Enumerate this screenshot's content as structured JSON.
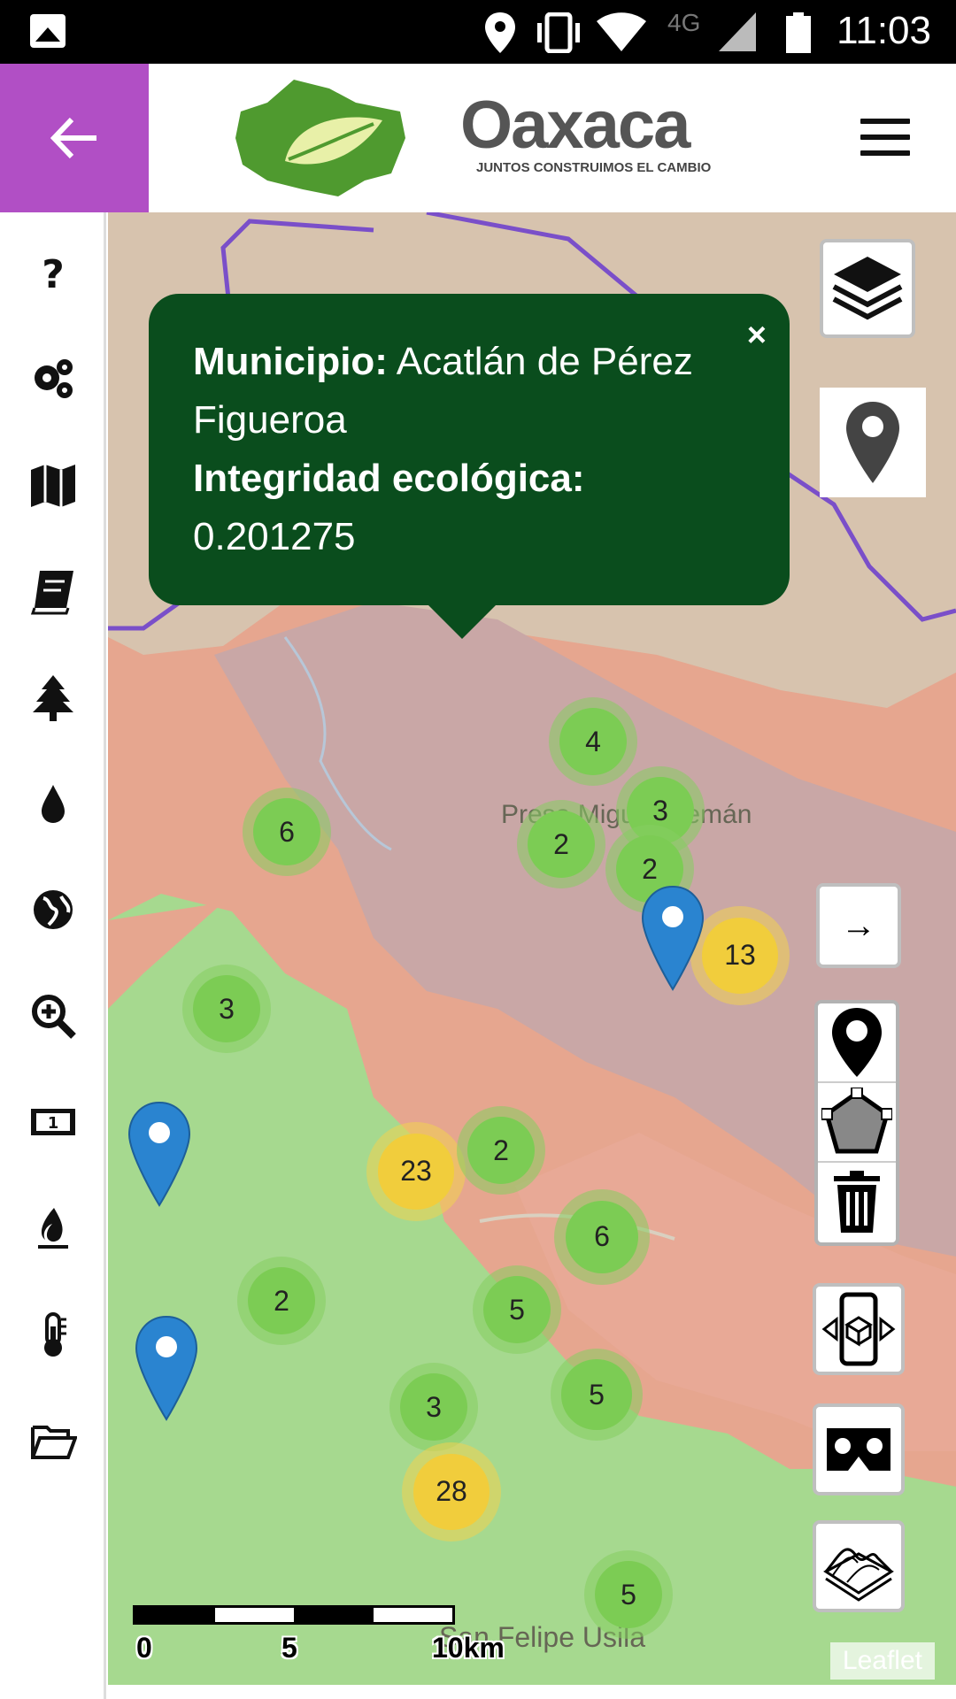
{
  "status_bar": {
    "network": "4G",
    "time": "11:03"
  },
  "header": {
    "brand_name": "Oaxaca",
    "brand_tagline": "JUNTOS CONSTRUIMOS EL CAMBIO"
  },
  "sidebar": {
    "items": [
      {
        "icon": "help-icon",
        "label": "?"
      },
      {
        "icon": "settings-icon"
      },
      {
        "icon": "map-icon"
      },
      {
        "icon": "book-icon"
      },
      {
        "icon": "tree-icon"
      },
      {
        "icon": "water-drop-icon"
      },
      {
        "icon": "globe-icon"
      },
      {
        "icon": "zoom-in-icon"
      },
      {
        "icon": "money-icon"
      },
      {
        "icon": "fire-icon"
      },
      {
        "icon": "thermometer-icon"
      },
      {
        "icon": "folder-open-icon"
      }
    ]
  },
  "popup": {
    "close": "×",
    "municipio_label": "Municipio:",
    "municipio_value": "Acatlán de Pérez Figueroa",
    "integridad_label": "Integridad ecológica:",
    "integridad_value": "0.201275"
  },
  "map": {
    "clusters": [
      {
        "count": "4",
        "color": "green"
      },
      {
        "count": "3",
        "color": "green"
      },
      {
        "count": "6",
        "color": "green"
      },
      {
        "count": "2",
        "color": "green"
      },
      {
        "count": "2",
        "color": "green"
      },
      {
        "count": "13",
        "color": "yellow"
      },
      {
        "count": "3",
        "color": "green"
      },
      {
        "count": "23",
        "color": "yellow"
      },
      {
        "count": "2",
        "color": "green"
      },
      {
        "count": "6",
        "color": "green"
      },
      {
        "count": "5",
        "color": "green"
      },
      {
        "count": "2",
        "color": "green"
      },
      {
        "count": "3",
        "color": "green"
      },
      {
        "count": "5",
        "color": "green"
      },
      {
        "count": "28",
        "color": "yellow"
      },
      {
        "count": "5",
        "color": "green"
      }
    ],
    "place_labels": [
      "Presa Miguel Alemán",
      "San Felipe Usila"
    ],
    "scale": {
      "zero": "0",
      "mid": "5",
      "end": "10km"
    },
    "attribution": "Leaflet",
    "controls": {
      "next_arrow": "→"
    }
  },
  "colors": {
    "accent_purple": "#b14fc5",
    "popup_green": "#0a4d1d",
    "cluster_green": "#7ccc54",
    "cluster_yellow": "#f1cd3c",
    "pin_blue": "#2a84d0"
  }
}
